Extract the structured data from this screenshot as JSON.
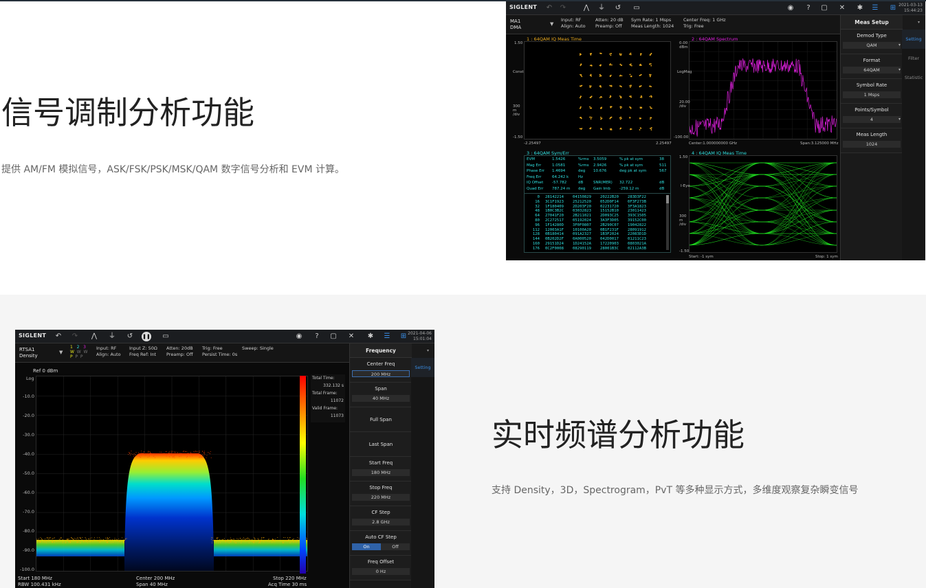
{
  "section1": {
    "title": "信号调制分析功能",
    "description": "提供 AM/FM 模拟信号，ASK/FSK/PSK/MSK/QAM 数字信号分析和 EVM 计算。",
    "screen": {
      "brand": "SIGLENT",
      "date": "2021-03-13",
      "time": "15:44:23",
      "mode_line1": "MA1",
      "mode_line2": "DMA",
      "info": [
        {
          "l1": "Input: RF",
          "l2": "Align: Auto"
        },
        {
          "l1": "Atten: 20 dB",
          "l2": "Preamp: Off"
        },
        {
          "l1": "Sym Rate: 1 Msps",
          "l2": "Meas Length: 1024"
        },
        {
          "l1": "Center Freq: 1 GHz",
          "l2": "Trig: Free"
        }
      ],
      "panel_title": "Meas Setup",
      "panel_items": [
        {
          "label": "Demod Type",
          "value": "QAM"
        },
        {
          "label": "Format",
          "value": "64QAM"
        },
        {
          "label": "Symbol Rate",
          "value": "1 Msps"
        },
        {
          "label": "Points/Symbol",
          "value": "4"
        },
        {
          "label": "Meas Length",
          "value": "1024"
        }
      ],
      "tabs": [
        "Setting",
        "Filter",
        "Statistic"
      ],
      "pane1": {
        "title": "1 :  64QAM  IQ Meas Time",
        "ytop": "1.50",
        "ymid1": "Const",
        "ymid2": "300 m /div",
        "ybot": "-1.50",
        "xleft": "-2.25497",
        "xright": "2.25497"
      },
      "pane2": {
        "title": "2 :  64QAM  Spectrum",
        "ytop": "0.00 dBm",
        "ymid1": "LogMag",
        "ymid2": "20.00 /div",
        "ybot": "-100.00",
        "xleft": "Center:1.000000000 GHz",
        "xright": "Span:3.125000 MHz"
      },
      "pane3": {
        "title": "3 :  64QAM  Sym/Err",
        "metrics": [
          [
            "EVM",
            "1.5426",
            "%rms",
            "3.5059",
            "% pk at sym",
            "38"
          ],
          [
            "Mag Err",
            "1.0581",
            "%rms",
            "2.9426",
            "% pk at sym",
            "511"
          ],
          [
            "Phase Err",
            "1.4694",
            "deg",
            "10.676",
            "deg pk at sym",
            "567"
          ],
          [
            "Freq Err",
            "64.242 k",
            "Hz",
            "",
            "",
            ""
          ],
          [
            "IQ Offset",
            "-57.782",
            "dB",
            "SNR(MER)",
            "32.722",
            "dB"
          ],
          [
            "Quad Err",
            "787.24 m",
            "deg",
            "Gain Imb",
            "-259.12 m",
            "dB"
          ]
        ],
        "symbols": [
          [
            "0",
            "28142214",
            "04150829",
            "20222B20",
            "283D3F22"
          ],
          [
            "16",
            "3C1F1923",
            "25212520",
            "052D0F14",
            "0F3F273B"
          ],
          [
            "32",
            "1F180409",
            "2D203F20",
            "02231720",
            "3F3A1823"
          ],
          [
            "48",
            "1B0C3B2C",
            "03032823",
            "15152B10",
            "23011423"
          ],
          [
            "64",
            "27041F20",
            "2B211021",
            "2D093C25",
            "393C1505"
          ],
          [
            "80",
            "2C272517",
            "05192024",
            "3A3F3D05",
            "39152C00"
          ],
          [
            "96",
            "1F14280D",
            "3F0F0807",
            "2B290C07",
            "19042822"
          ],
          [
            "112",
            "12003A1F",
            "10100A20",
            "0B1F231F",
            "28091912"
          ],
          [
            "128",
            "0B180414",
            "091A2327",
            "1B3F2024",
            "22083D1D"
          ],
          [
            "144",
            "0B202D2F",
            "0A000520",
            "042D0017",
            "01211C23"
          ],
          [
            "160",
            "29151D24",
            "1D24152A",
            "17220903",
            "0803021A"
          ],
          [
            "176",
            "0C2F0008",
            "08290119",
            "28001B3C",
            "02112A3B"
          ]
        ]
      },
      "pane4": {
        "title": "4 :  64QAM  IQ Meas Time",
        "ytop": "1.50",
        "ymid1": "I-Eye",
        "ymid2": "300 m /div",
        "ybot": "-1.50",
        "xleft": "Start: -1 sym",
        "xright": "Stop: 1 sym"
      },
      "colors": {
        "yellow": "#e8a81c",
        "magenta": "#e020e0",
        "green": "#20e020",
        "cyan": "#30e0e0"
      }
    }
  },
  "section2": {
    "title": "实时频谱分析功能",
    "description": "支持 Density，3D，Spectrogram，PvT 等多种显示方式，多维度观察复杂瞬变信号",
    "screen": {
      "brand": "SIGLENT",
      "date": "2021-04-06",
      "time": "15:01:04",
      "mode_line1": "RTSA1",
      "mode_line2": "Density",
      "traces": [
        "1",
        "2",
        "3"
      ],
      "trace_letters": [
        "W",
        "W",
        "W",
        "P",
        "P",
        "P"
      ],
      "info": [
        {
          "l1": "Input: RF",
          "l2": "Align: Auto"
        },
        {
          "l1": "Input Z: 50Ω",
          "l2": "Freq Ref: Int"
        },
        {
          "l1": "Atten: 20dB",
          "l2": "Preamp: Off"
        },
        {
          "l1": "Trig: Free",
          "l2": "Persist Time: 0s"
        },
        {
          "l1": "Sweep: Single",
          "l2": ""
        }
      ],
      "ref": "Ref  0 dBm",
      "log": "Log",
      "yticks": [
        "-10.0",
        "-20.0",
        "-30.0",
        "-40.0",
        "-50.0",
        "-60.0",
        "-70.0",
        "-80.0",
        "-90.0",
        "-100.0"
      ],
      "stats": [
        {
          "label": "Total Time:",
          "value": "332.132 s"
        },
        {
          "label": "Total Frame:",
          "value": "11072"
        },
        {
          "label": "Valid Frame:",
          "value": "11073"
        }
      ],
      "bottom": {
        "start": "Start  180 MHz",
        "rbw": "RBW  100.431 kHz",
        "center": "Center  200 MHz",
        "span": "Span  40 MHz",
        "stop": "Stop  220 MHz",
        "acq": "Acq Time  30 ms"
      },
      "panel_title": "Frequency",
      "panel_items": [
        {
          "label": "Center Freq",
          "value": "200 MHz",
          "selected": true
        },
        {
          "label": "Span",
          "value": "40 MHz"
        },
        {
          "label": "Full Span",
          "value": ""
        },
        {
          "label": "Last Span",
          "value": ""
        },
        {
          "label": "Start Freq",
          "value": "180 MHz"
        },
        {
          "label": "Stop Freq",
          "value": "220 MHz"
        },
        {
          "label": "CF Step",
          "value": "2.8 GHz"
        },
        {
          "label": "Auto CF Step",
          "on": "On",
          "off": "Off"
        },
        {
          "label": "Freq Offset",
          "value": "0 Hz"
        }
      ],
      "tabs": [
        "Setting"
      ]
    }
  }
}
